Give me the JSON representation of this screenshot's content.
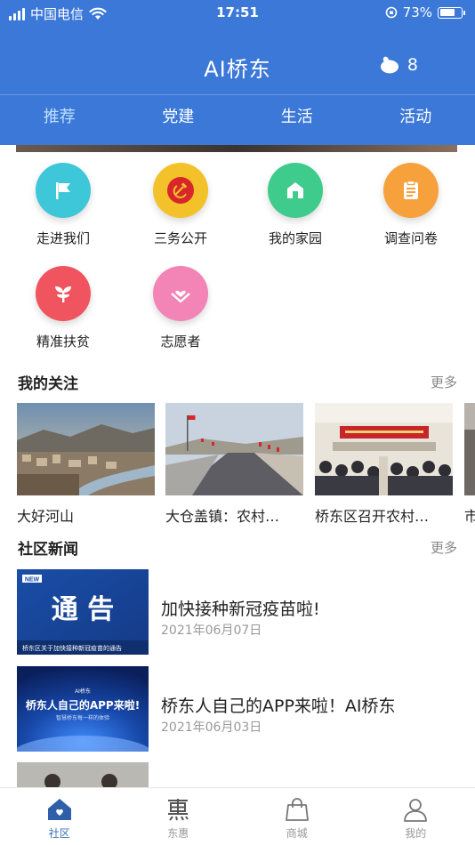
{
  "status_bar": {
    "carrier": "中国电信",
    "time": "17:51",
    "battery": "73%",
    "battery_level": 0.73
  },
  "header": {
    "title": "AI桥东",
    "points": "8",
    "points_icon": "piggy-icon"
  },
  "tabs": [
    {
      "label": "推荐"
    },
    {
      "label": "党建"
    },
    {
      "label": "生活"
    },
    {
      "label": "活动"
    }
  ],
  "grid": [
    {
      "label": "走进我们",
      "icon": "flag-icon",
      "color": "#3ec7d8"
    },
    {
      "label": "三务公开",
      "icon": "hammer-sickle-icon",
      "color": "#f3c22a"
    },
    {
      "label": "我的家园",
      "icon": "home-icon",
      "color": "#3ecb8b"
    },
    {
      "label": "调查问卷",
      "icon": "clipboard-icon",
      "color": "#f7a13c"
    },
    {
      "label": "精准扶贫",
      "icon": "sprout-icon",
      "color": "#f0545e"
    },
    {
      "label": "志愿者",
      "icon": "heart-hands-icon",
      "color": "#f284b6"
    }
  ],
  "follow": {
    "title": "我的关注",
    "more": "更多",
    "cards": [
      {
        "title": "大好河山"
      },
      {
        "title": "大仓盖镇：农村…"
      },
      {
        "title": "桥东区召开农村…"
      },
      {
        "title": "市"
      }
    ]
  },
  "news": {
    "title": "社区新闻",
    "more": "更多",
    "items": [
      {
        "title": "加快接种新冠疫苗啦!",
        "date": "2021年06月07日",
        "thumb_badge": "NEW",
        "thumb_heading": "通 告",
        "thumb_caption": "桥东区关于加快接种新冠疫苗的通告"
      },
      {
        "title": "桥东人自己的APP来啦！AI桥东",
        "date": "2021年06月03日",
        "thumb_badge": "AI桥东",
        "thumb_heading": "桥东人自己的APP来啦!",
        "thumb_caption": "智慧桥东每一样的体验"
      },
      {
        "title": "",
        "date": ""
      }
    ]
  },
  "bottom_nav": [
    {
      "label": "社区",
      "icon": "community-home-icon",
      "active": true
    },
    {
      "label": "东惠",
      "icon": "hui-icon",
      "active": false
    },
    {
      "label": "商城",
      "icon": "shopping-bag-icon",
      "active": false
    },
    {
      "label": "我的",
      "icon": "user-icon",
      "active": false
    }
  ],
  "colors": {
    "brand_blue": "#3b78d8",
    "active_tab": "#bfe0ff"
  }
}
